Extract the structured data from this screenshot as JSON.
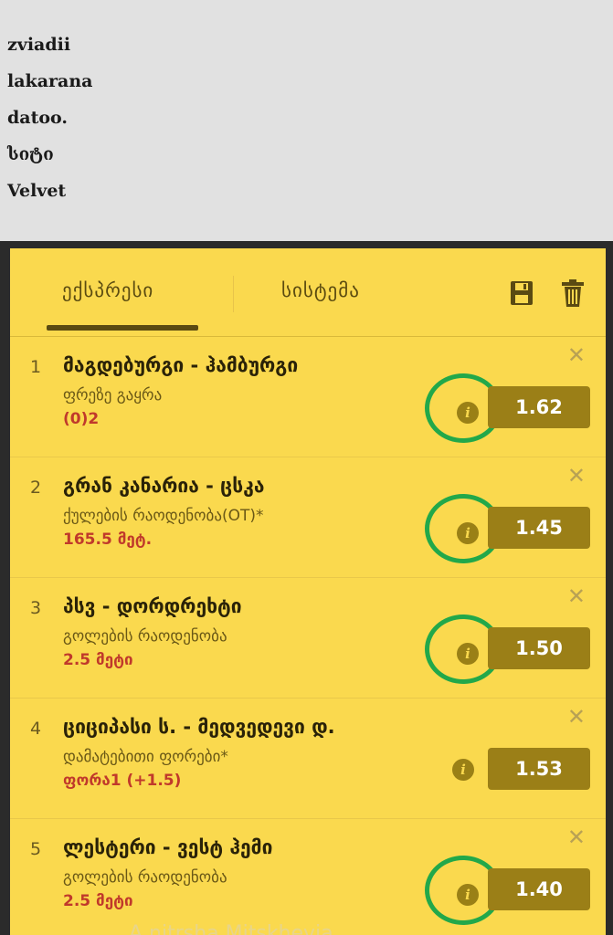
{
  "users": [
    "zviadii",
    "lakarana",
    "datoo.",
    "სიტი",
    "Velvet"
  ],
  "betslip": {
    "tabs": [
      {
        "label": "ექსპრესი",
        "active": true
      },
      {
        "label": "სისტემა",
        "active": false
      }
    ],
    "icons": {
      "save": "save-icon",
      "trash": "trash-icon"
    },
    "bets": [
      {
        "num": "1",
        "match": "მაგდებურგი - ჰამბურგი",
        "market": "ფრეზე გაყრა",
        "pick": "(0)2",
        "odds": "1.62",
        "highlighted": true
      },
      {
        "num": "2",
        "match": "გრან კანარია - ცსკა",
        "market": "ქულების რაოდენობა(OT)*",
        "pick": "165.5 მეტ.",
        "odds": "1.45",
        "highlighted": true
      },
      {
        "num": "3",
        "match": "პსვ - დორდრეხტი",
        "market": "გოლების რაოდენობა",
        "pick": "2.5 მეტი",
        "odds": "1.50",
        "highlighted": true
      },
      {
        "num": "4",
        "match": "ციციპასი ს. - მედვედევი დ.",
        "market": "დამატებითი ფორები*",
        "pick": "ფორა1 (+1.5)",
        "odds": "1.53",
        "highlighted": false
      },
      {
        "num": "5",
        "match": "ლესტერი - ვესტ ჰემი",
        "market": "გოლების რაოდენობა",
        "pick": "2.5 მეტი",
        "odds": "1.40",
        "highlighted": true
      }
    ],
    "footer_faded": "A nitrsha Mitskhevia"
  },
  "colors": {
    "panel": "#fad94e",
    "odds_bg": "#9b7f17",
    "pick_red": "#c0392b",
    "highlight_circle": "#22a84a"
  }
}
